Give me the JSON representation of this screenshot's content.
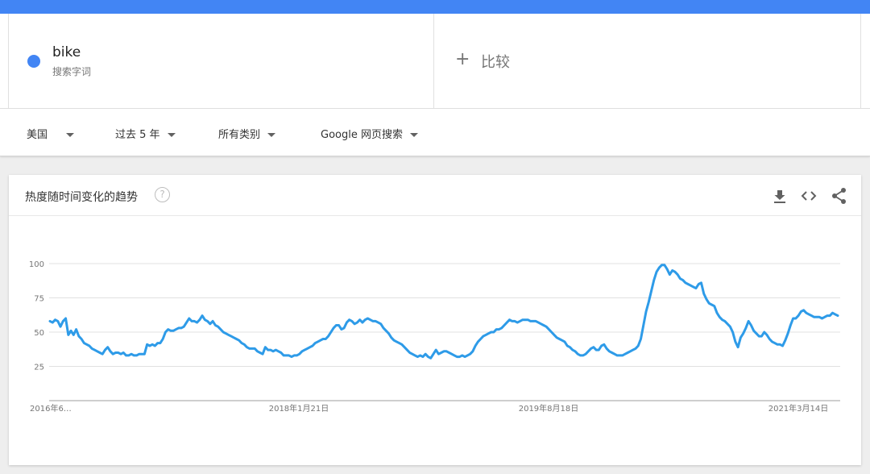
{
  "search_term": {
    "name": "bike",
    "subtitle": "搜索字词"
  },
  "compare": {
    "plus": "+",
    "label": "比较"
  },
  "filters": {
    "region": "美国",
    "time_range": "过去 5 年",
    "category": "所有类别",
    "search_type": "Google 网页搜索"
  },
  "card": {
    "title": "热度随时间变化的趋势",
    "help": "?"
  },
  "colors": {
    "accent": "#4285f4",
    "series": "#2e9be8",
    "grid": "#e0e0e0"
  },
  "icons": [
    "download-icon",
    "embed-icon",
    "share-icon"
  ],
  "chart_data": {
    "type": "line",
    "x_tick_labels": [
      "2016年6…",
      "2018年1月21日",
      "2019年8月18日",
      "2021年3月14日"
    ],
    "y_ticks": [
      25,
      50,
      75,
      100
    ],
    "ylim": [
      0,
      100
    ],
    "grid": true,
    "series": [
      {
        "color": "#2e9be8",
        "values": [
          58,
          57,
          59,
          58,
          54,
          58,
          60,
          48,
          51,
          48,
          52,
          47,
          45,
          42,
          41,
          40,
          38,
          37,
          36,
          35,
          34,
          37,
          39,
          36,
          34,
          35,
          35,
          34,
          35,
          33,
          33,
          34,
          33,
          33,
          34,
          34,
          34,
          41,
          40,
          41,
          40,
          42,
          42,
          45,
          50,
          52,
          51,
          51,
          52,
          53,
          53,
          54,
          57,
          60,
          58,
          58,
          57,
          59,
          62,
          59,
          58,
          56,
          58,
          55,
          54,
          52,
          50,
          49,
          48,
          47,
          46,
          45,
          44,
          42,
          41,
          39,
          38,
          38,
          38,
          36,
          35,
          34,
          39,
          37,
          37,
          36,
          37,
          36,
          35,
          33,
          33,
          33,
          32,
          33,
          33,
          34,
          36,
          37,
          38,
          39,
          40,
          42,
          43,
          44,
          45,
          45,
          47,
          50,
          53,
          55,
          55,
          52,
          53,
          57,
          59,
          58,
          56,
          57,
          59,
          57,
          59,
          60,
          59,
          58,
          58,
          57,
          56,
          53,
          51,
          49,
          46,
          44,
          43,
          42,
          41,
          39,
          37,
          35,
          34,
          33,
          32,
          33,
          32,
          34,
          32,
          31,
          34,
          37,
          34,
          35,
          36,
          36,
          35,
          34,
          33,
          32,
          32,
          33,
          32,
          33,
          34,
          36,
          40,
          43,
          45,
          47,
          48,
          49,
          50,
          50,
          52,
          52,
          53,
          55,
          57,
          59,
          58,
          58,
          57,
          58,
          59,
          59,
          59,
          58,
          58,
          58,
          57,
          56,
          55,
          54,
          52,
          50,
          48,
          46,
          45,
          44,
          43,
          40,
          39,
          37,
          36,
          34,
          33,
          33,
          34,
          36,
          38,
          39,
          37,
          37,
          40,
          41,
          38,
          36,
          35,
          34,
          33,
          33,
          33,
          34,
          35,
          36,
          37,
          38,
          40,
          45,
          55,
          65,
          72,
          80,
          88,
          94,
          97,
          99,
          99,
          96,
          92,
          95,
          94,
          92,
          89,
          88,
          86,
          85,
          84,
          83,
          82,
          85,
          86,
          78,
          74,
          71,
          70,
          69,
          64,
          61,
          59,
          58,
          56,
          54,
          50,
          43,
          39,
          46,
          49,
          53,
          58,
          55,
          51,
          49,
          47,
          47,
          50,
          48,
          45,
          43,
          42,
          41,
          41,
          40,
          44,
          49,
          55,
          60,
          60,
          62,
          65,
          66,
          64,
          63,
          62,
          61,
          61,
          61,
          60,
          61,
          62,
          62,
          64,
          63,
          62
        ]
      }
    ]
  }
}
